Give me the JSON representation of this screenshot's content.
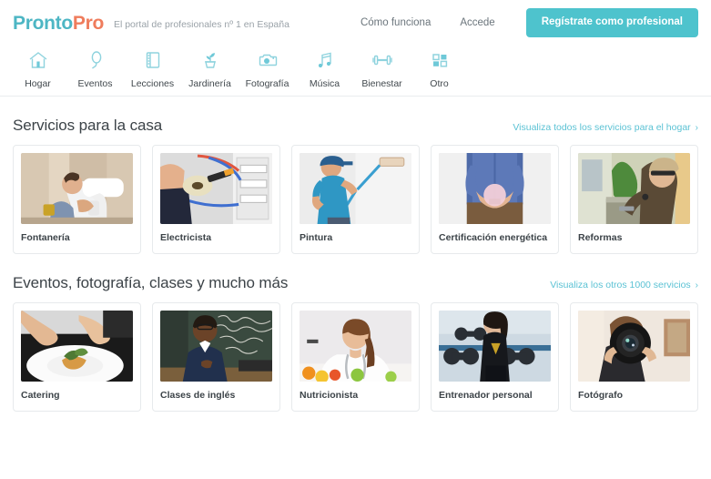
{
  "header": {
    "logo_primary": "Pronto",
    "logo_secondary": "Pro",
    "tagline": "El portal de profesionales nº 1 en España",
    "link_how": "Cómo funciona",
    "link_login": "Accede",
    "cta_label": "Regístrate como profesional",
    "colors": {
      "logo_primary": "#4db6c4",
      "logo_secondary": "#ef7c5c",
      "cta_bg": "#4ec3cd",
      "link": "#5bc2d4"
    }
  },
  "nav": {
    "items": [
      {
        "label": "Hogar",
        "icon": "house-icon"
      },
      {
        "label": "Eventos",
        "icon": "balloon-icon"
      },
      {
        "label": "Lecciones",
        "icon": "notebook-icon"
      },
      {
        "label": "Jardinería",
        "icon": "potted-plant-icon"
      },
      {
        "label": "Fotografía",
        "icon": "camera-icon"
      },
      {
        "label": "Música",
        "icon": "music-note-icon"
      },
      {
        "label": "Bienestar",
        "icon": "dumbbell-icon"
      },
      {
        "label": "Otro",
        "icon": "grid-squares-icon"
      }
    ]
  },
  "sections": [
    {
      "title": "Servicios para la casa",
      "link": "Visualiza todos los servicios para el hogar",
      "chevron": "›",
      "cards": [
        {
          "label": "Fontanería",
          "image": "plumber-under-sink"
        },
        {
          "label": "Electricista",
          "image": "electrician-wiring-panel"
        },
        {
          "label": "Pintura",
          "image": "painter-with-roller"
        },
        {
          "label": "Certificación energética",
          "image": "hands-holding-lightbulb"
        },
        {
          "label": "Reformas",
          "image": "worker-with-hardhat"
        }
      ]
    },
    {
      "title": "Eventos, fotografía, clases y mucho más",
      "link": "Visualiza los otros 1000 servicios",
      "chevron": "›",
      "cards": [
        {
          "label": "Catering",
          "image": "chef-plating-dish"
        },
        {
          "label": "Clases de inglés",
          "image": "teacher-at-blackboard"
        },
        {
          "label": "Nutricionista",
          "image": "nutritionist-with-apple"
        },
        {
          "label": "Entrenador personal",
          "image": "trainer-in-gym"
        },
        {
          "label": "Fotógrafo",
          "image": "photographer-with-camera"
        }
      ]
    }
  ]
}
